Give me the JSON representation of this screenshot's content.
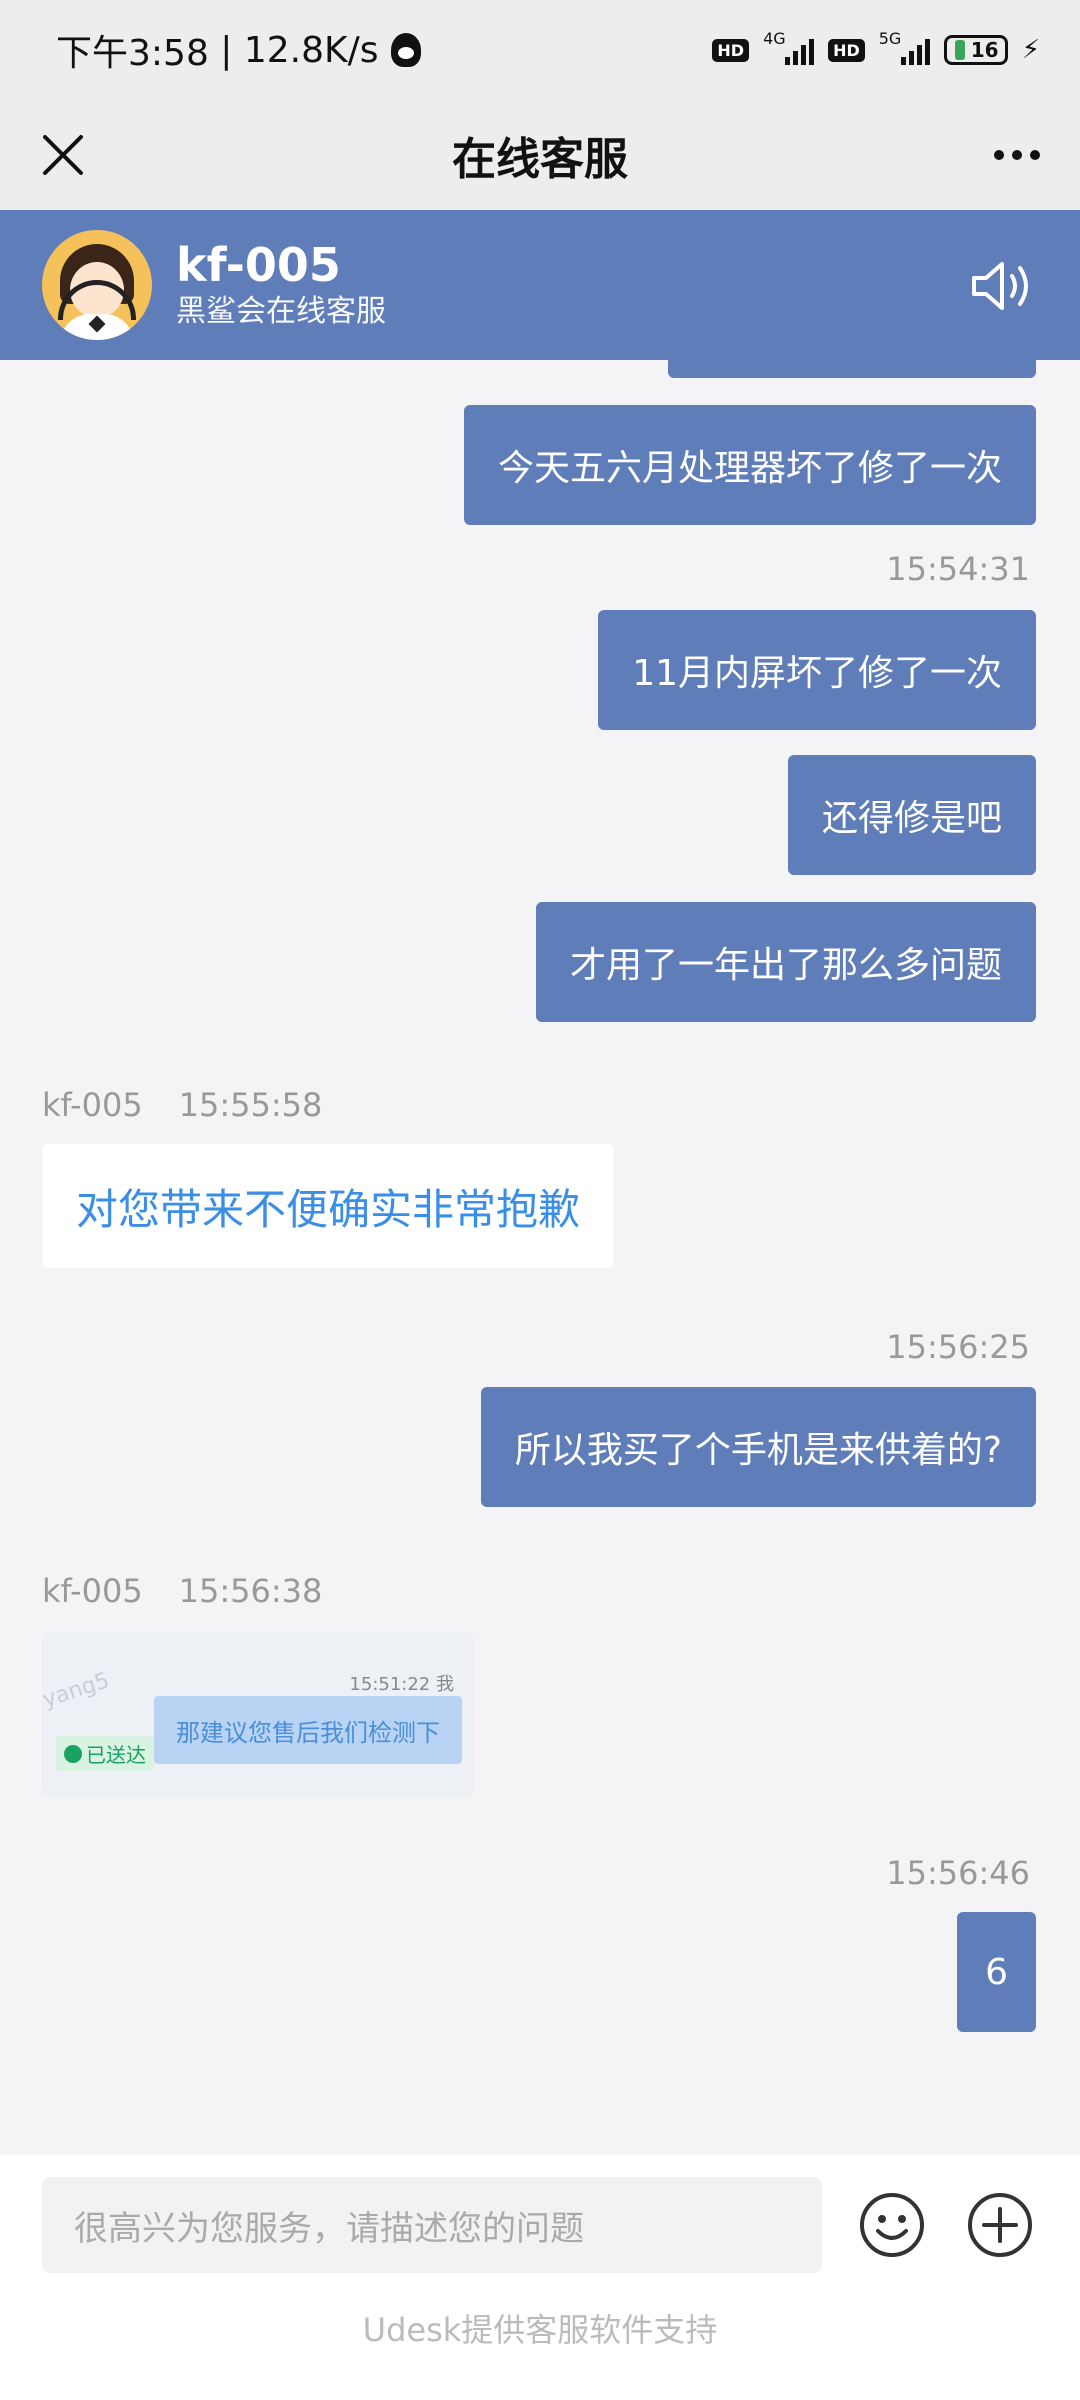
{
  "status_bar": {
    "time": "下午3:58",
    "speed": "12.8K/s",
    "hd1": "HD",
    "net1": "4G",
    "hd2": "HD",
    "net2": "5G",
    "battery": "16"
  },
  "nav": {
    "title": "在线客服",
    "close_icon": "close-icon",
    "more_icon": "more-icon"
  },
  "agent": {
    "name": "kf-005",
    "subtitle": "黑鲨会在线客服",
    "speaker_icon": "speaker-icon"
  },
  "messages": {
    "out1": "今天五六月处理器坏了修了一次",
    "ts1": "15:54:31",
    "out2": "11月内屏坏了修了一次",
    "out3": "还得修是吧",
    "out4": "才用了一年出了那么多问题",
    "in1_sender": "kf-005",
    "in1_time": "15:55:58",
    "in1_text": "对您带来不便确实非常抱歉",
    "ts2": "15:56:25",
    "out5": "所以我买了个手机是来供着的?",
    "in2_sender": "kf-005",
    "in2_time": "15:56:38",
    "image": {
      "timestamp": "15:51:22 我",
      "bubble_text": "那建议您售后我们检测下",
      "sent_badge": "已送达",
      "watermark": "yang5"
    },
    "ts3": "15:56:46",
    "out6": "6"
  },
  "input": {
    "placeholder": "很高兴为您服务，请描述您的问题"
  },
  "footer": "Udesk提供客服软件支持",
  "colors": {
    "accent": "#5f7db8",
    "agent_text": "#3a8ee6",
    "background": "#f4f4f6"
  }
}
